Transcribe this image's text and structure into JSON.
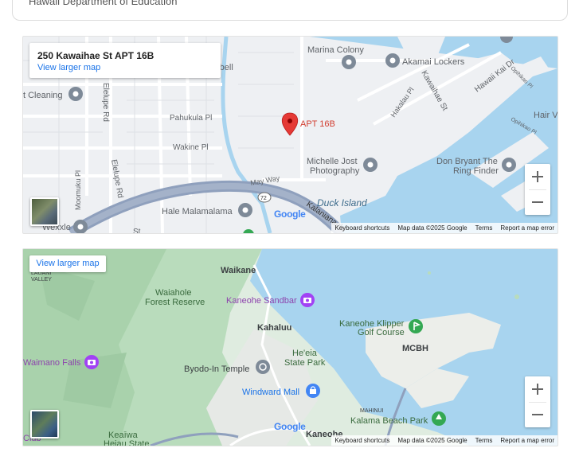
{
  "top_card": {
    "caption": "Hawaii Department of Education"
  },
  "map1": {
    "address": "250 Kawaihae St APT 16B",
    "view_larger": "View larger map",
    "pin_label": "APT 16B",
    "labels": {
      "marina_colony": "Marina Colony",
      "akamai_lockers": "Akamai Lockers",
      "barbell": "rbell",
      "cleaning": "t Cleaning",
      "pahukula": "Pahukula Pl",
      "wakine": "Wakine Pl",
      "elelupe_rd_top": "Elelupe Rd",
      "elelupe_rd_bottom": "Elelupe Rd",
      "moomuku": "Moomuku Pl",
      "kawaihae_st": "Kawaihae St",
      "hawaii_kai_dr": "Hawaii Kai Dr",
      "hakalau": "Hakalau Pl",
      "opihikao_1": "Opihikao Pl",
      "opihikao_2": "Opihikao Pl",
      "hair": "Hair V",
      "michelle": "Michelle Jost",
      "photography": "Photography",
      "don_bryant": "Don Bryant The",
      "ring_finder": "Ring Finder",
      "may_way": "May Way",
      "route": "72",
      "duck_island": "Duck Island",
      "hale": "Hale Malamalama",
      "kalanianaole": "Kalanianaole",
      "wexxle": "Wexxle",
      "st": "St"
    },
    "footer": {
      "shortcuts": "Keyboard shortcuts",
      "data": "Map data ©2025 Google",
      "terms": "Terms",
      "report": "Report a map error"
    }
  },
  "map2": {
    "view_larger": "View larger map",
    "labels": {
      "waikane": "Waikane",
      "lauani": "LAUANI",
      "valley": "VALLEY",
      "waiahole": "Waiahole",
      "forest_reserve": "Forest Reserve",
      "kaneohe_sandbar": "Kaneohe Sandbar",
      "kahaluu": "Kahaluu",
      "kaneohe_klipper": "Kaneohe Klipper",
      "golf_course": "Golf Course",
      "mcbh": "MCBH",
      "waimano_falls": "Waimano Falls",
      "byodo_in": "Byodo-In Temple",
      "heeia": "He'eia",
      "state_park": "State Park",
      "windward_mall": "Windward Mall",
      "mahinui": "MAHINUI",
      "kalama_beach": "Kalama Beach Park",
      "keaiwa": "Keaīwa",
      "heiau_state": "Heiau State",
      "kaneohe": "Kaneohe",
      "club": "Club"
    },
    "footer": {
      "shortcuts": "Keyboard shortcuts",
      "data": "Map data ©2025 Google",
      "terms": "Terms",
      "report": "Report a map error"
    }
  },
  "google_logo": "Google",
  "icons": [
    "map-pin-icon",
    "place-marker-icon",
    "camera-marker-icon",
    "golf-marker-icon",
    "shopping-bag-icon",
    "temple-icon",
    "park-marker-icon",
    "route-shield-icon",
    "zoom-in-icon",
    "zoom-out-icon",
    "satellite-thumbnail-icon"
  ],
  "colors": {
    "water": "#a8d4ef",
    "road_highway": "#8fa0bd",
    "pin": "#e53935",
    "link": "#1a73e8",
    "park": "#b9dcbc",
    "land": "#eef0f3"
  }
}
